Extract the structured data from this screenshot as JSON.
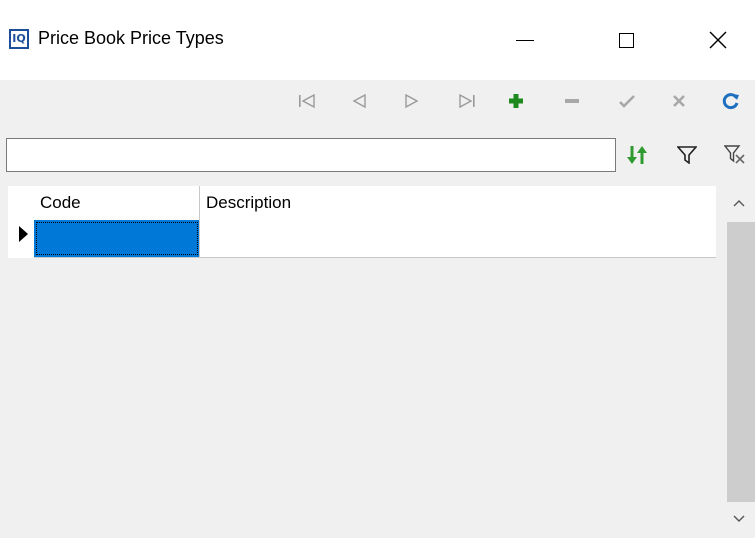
{
  "window": {
    "title": "Price Book Price Types",
    "app_icon_label": "IQ"
  },
  "navigator": {
    "buttons": [
      {
        "name": "first-record",
        "icon": "first-icon",
        "glyph": "|◀",
        "color": "#9a9a9a"
      },
      {
        "name": "prior-record",
        "icon": "prev-icon",
        "glyph": "◀",
        "color": "#9a9a9a"
      },
      {
        "name": "next-record",
        "icon": "next-icon",
        "glyph": "▶",
        "color": "#9a9a9a"
      },
      {
        "name": "last-record",
        "icon": "last-icon",
        "glyph": "▶|",
        "color": "#9a9a9a"
      },
      {
        "name": "insert-record",
        "icon": "plus-icon",
        "glyph": "+",
        "color": "#1e8a1e"
      },
      {
        "name": "delete-record",
        "icon": "minus-icon",
        "glyph": "—",
        "color": "#9a9a9a"
      },
      {
        "name": "post-record",
        "icon": "check-icon",
        "glyph": "✔",
        "color": "#9a9a9a"
      },
      {
        "name": "cancel-record",
        "icon": "cancel-x-icon",
        "glyph": "✖",
        "color": "#9a9a9a"
      },
      {
        "name": "refresh-record",
        "icon": "refresh-icon",
        "glyph": "↻",
        "color": "#1e6fc0"
      }
    ]
  },
  "search": {
    "value": "",
    "placeholder": ""
  },
  "grid": {
    "columns": [
      {
        "label": "Code"
      },
      {
        "label": "Description"
      }
    ],
    "rows": [
      {
        "code": "",
        "description": "",
        "selected": true
      }
    ]
  },
  "colors": {
    "selection": "#0078d7",
    "sort_icon": "#2f9a2f",
    "refresh_icon": "#1e6fc0"
  }
}
